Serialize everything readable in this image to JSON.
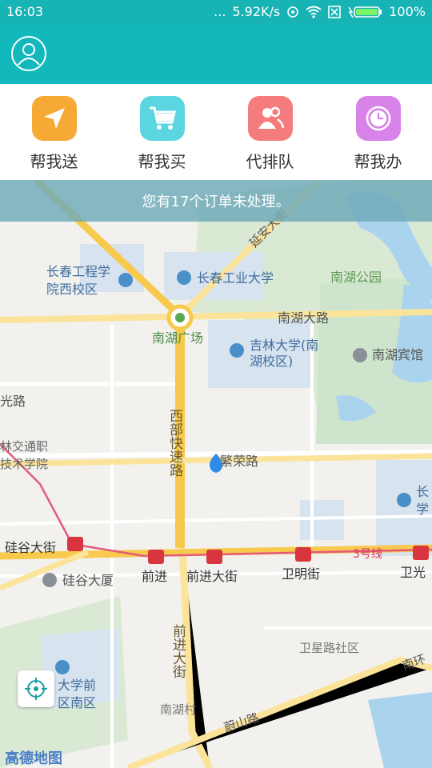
{
  "status_bar": {
    "time": "16:03",
    "network_speed": "5.92K/s",
    "battery": "100%",
    "dots": "..."
  },
  "services": [
    {
      "label": "帮我送",
      "icon": "send-icon",
      "color": "#f6a935"
    },
    {
      "label": "帮我买",
      "icon": "cart-icon",
      "color": "#5bd6e0"
    },
    {
      "label": "代排队",
      "icon": "queue-icon",
      "color": "#f57c7c"
    },
    {
      "label": "帮我办",
      "icon": "clock-icon",
      "color": "#d883ea"
    }
  ],
  "banner": {
    "text": "您有17个订单未处理。"
  },
  "map": {
    "labels": {
      "changchun_engineering": "长春工程学",
      "changchun_engineering_2": "院西校区",
      "changchun_industry": "长春工业大学",
      "nanhu_park": "南湖公园",
      "nanhu_road": "南湖大路",
      "nanhu_square": "南湖广场",
      "jilin_univ": "吉林大学(南",
      "jilin_univ_2": "湖校区)",
      "nanhu_hotel": "南湖宾馆",
      "yanan_street": "延安大街",
      "xibu_expressway": "西部快速路",
      "guang_road": "光路",
      "jiaotong": "林交通职",
      "jiaotong_2": "技术学院",
      "fanrong_road": "繁荣路",
      "changchun_right": "长",
      "changchun_right_2": "学",
      "guigu_street": "硅谷大街",
      "guigu_building": "硅谷大厦",
      "qianjin": "前进",
      "qianjin_street": "前进大街",
      "weiming_street": "卫明街",
      "weiguang": "卫光",
      "line3": "3号线",
      "qianjin_vertical": "前进大街",
      "weixing_community": "卫星路社区",
      "nanhuan": "南环",
      "univ_south": "大学前",
      "univ_south_2": "区南区",
      "nanhu_village": "南湖村",
      "weishan_road": "蔚山路"
    }
  },
  "footer": {
    "map_logo": "高德地图"
  }
}
